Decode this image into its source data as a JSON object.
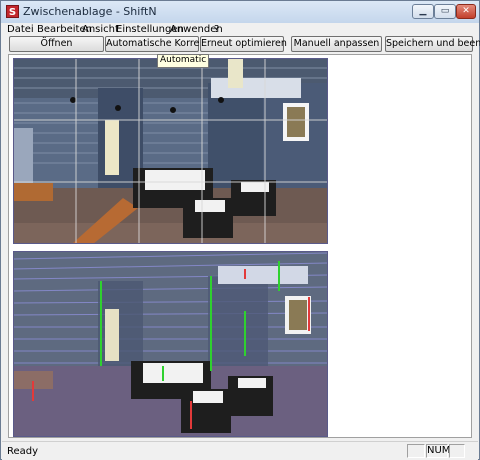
{
  "window": {
    "title": "Zwischenablage - ShiftN",
    "app_icon_letter": "S"
  },
  "menu": [
    {
      "label": "Datei"
    },
    {
      "label": "Bearbeiten"
    },
    {
      "label": "Ansicht"
    },
    {
      "label": "Einstellungen"
    },
    {
      "label": "Anwenden"
    },
    {
      "label": "?"
    }
  ],
  "toolbar": [
    {
      "label": "Öffnen"
    },
    {
      "label": "Automatische Korrektur"
    },
    {
      "label": "Erneut optimieren"
    },
    {
      "label": "Manuell anpassen"
    },
    {
      "label": "Speichern und beenden"
    }
  ],
  "tooltip": "Automatic",
  "status": {
    "text": "Ready",
    "num": "NUM"
  },
  "colors": {
    "titlebar": "#c4d6ec",
    "accent_edges": "#7a5cff"
  }
}
